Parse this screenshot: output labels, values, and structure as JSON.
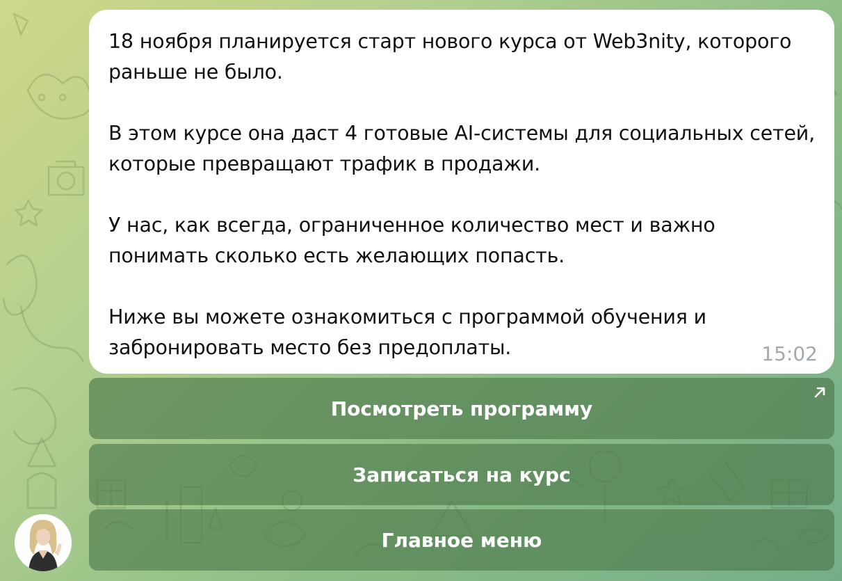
{
  "message": {
    "text": "18 ноября планируется старт нового курса от Web3nity, которого раньше не было.\n\nВ этом курсе она даст 4 готовые AI-системы для социальных сетей, которые превращают трафик в продажи.\n\nУ нас, как всегда, ограниченное количество мест и важно понимать сколько есть желающих попасть.\n\nНиже вы можете ознакомиться с программой обучения и забронировать место без предоплаты.",
    "time": "15:02"
  },
  "buttons": [
    {
      "label": "Посмотреть программу",
      "icon": "external-link-arrow-icon"
    },
    {
      "label": "Записаться на курс"
    },
    {
      "label": "Главное меню"
    }
  ],
  "colors": {
    "bubble": "#ffffff",
    "button_bg": "#4a7649",
    "time": "#a3a9ae",
    "wallpaper_top": "#cfd88a",
    "wallpaper_bottom": "#74ad88"
  }
}
